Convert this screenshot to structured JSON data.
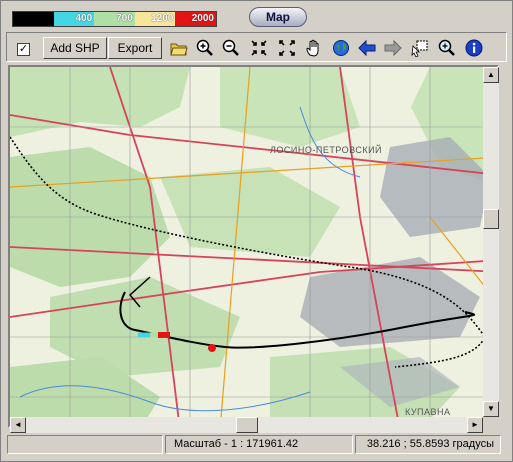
{
  "legend": {
    "segments": [
      {
        "label": "",
        "color": "#000000"
      },
      {
        "label": "400",
        "color": "#45d6e6"
      },
      {
        "label": "700",
        "color": "#aee0a6"
      },
      {
        "label": "1200",
        "color": "#f7e69a"
      },
      {
        "label": "2000",
        "color": "#e21515"
      }
    ]
  },
  "title_button": "Map",
  "toolbar": {
    "checkbox_checked": true,
    "checkbox_mark": "✓",
    "add_shp": "Add SHP",
    "export": "Export",
    "icons": [
      "open-folder-icon",
      "zoom-in-icon",
      "zoom-out-icon",
      "zoom-extent-in-icon",
      "zoom-extent-out-icon",
      "pan-hand-icon",
      "globe-icon",
      "back-arrow-icon",
      "forward-arrow-icon",
      "select-region-icon",
      "zoom-window-icon",
      "info-icon"
    ]
  },
  "map": {
    "labels": [
      "ЛОСИНО-ПЕТРОВСКИЙ",
      "КУПАВНА"
    ],
    "colors": {
      "forest": "#b8dcae",
      "road": "#d8425a",
      "track": "#000000",
      "urban": "#9aa0a8"
    }
  },
  "scrollbars": {
    "up_arrow": "▲",
    "down_arrow": "▼",
    "left_arrow": "◄",
    "right_arrow": "►"
  },
  "status": {
    "cell1": "",
    "scale": "Масштаб - 1 : 171961.42",
    "coords": "38.216  ;  55.8593 градусы"
  }
}
